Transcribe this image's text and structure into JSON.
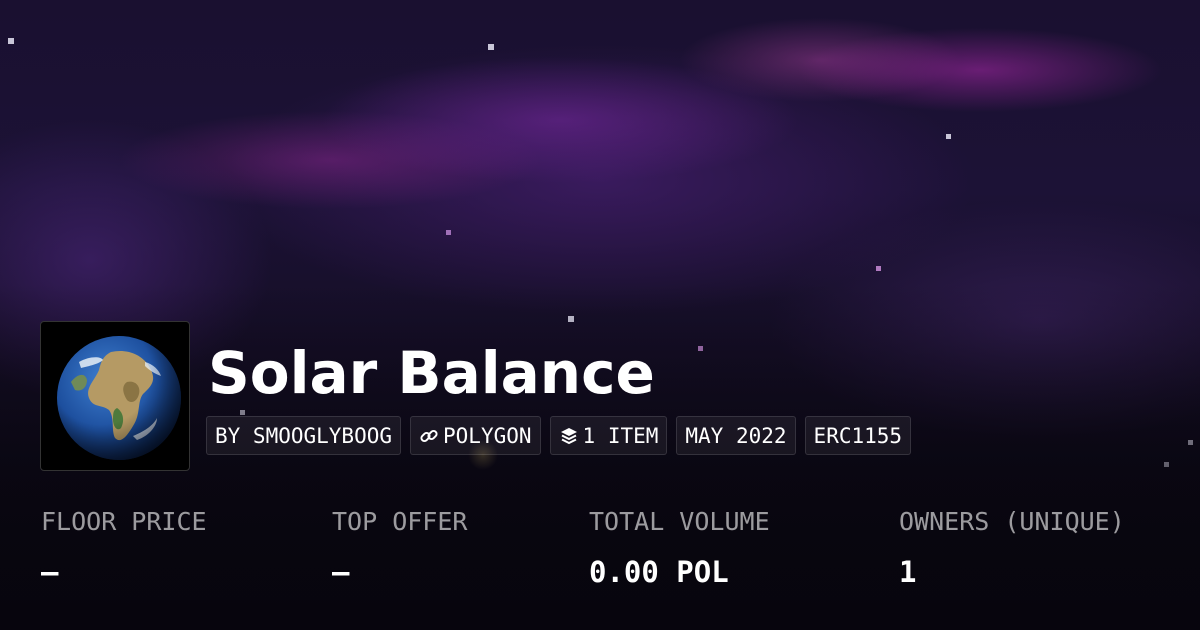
{
  "collection": {
    "title": "Solar Balance",
    "avatar_icon": "earth-globe"
  },
  "chips": {
    "creator": "BY SMOOGLYBOOG",
    "chain": "POLYGON",
    "chain_icon": "link-icon",
    "items": "1 ITEM",
    "items_icon": "layers-icon",
    "date": "MAY 2022",
    "standard": "ERC1155"
  },
  "stats": {
    "floor_price": {
      "label": "FLOOR PRICE",
      "value": "–"
    },
    "top_offer": {
      "label": "TOP OFFER",
      "value": "–"
    },
    "total_volume": {
      "label": "TOTAL VOLUME",
      "value": "0.00 POL"
    },
    "owners": {
      "label": "OWNERS (UNIQUE)",
      "value": "1"
    }
  },
  "colors": {
    "background": "#0d0a14",
    "nebula_purple": "#7a2aa0",
    "text_primary": "#ffffff",
    "text_muted": "#9a98a4"
  }
}
